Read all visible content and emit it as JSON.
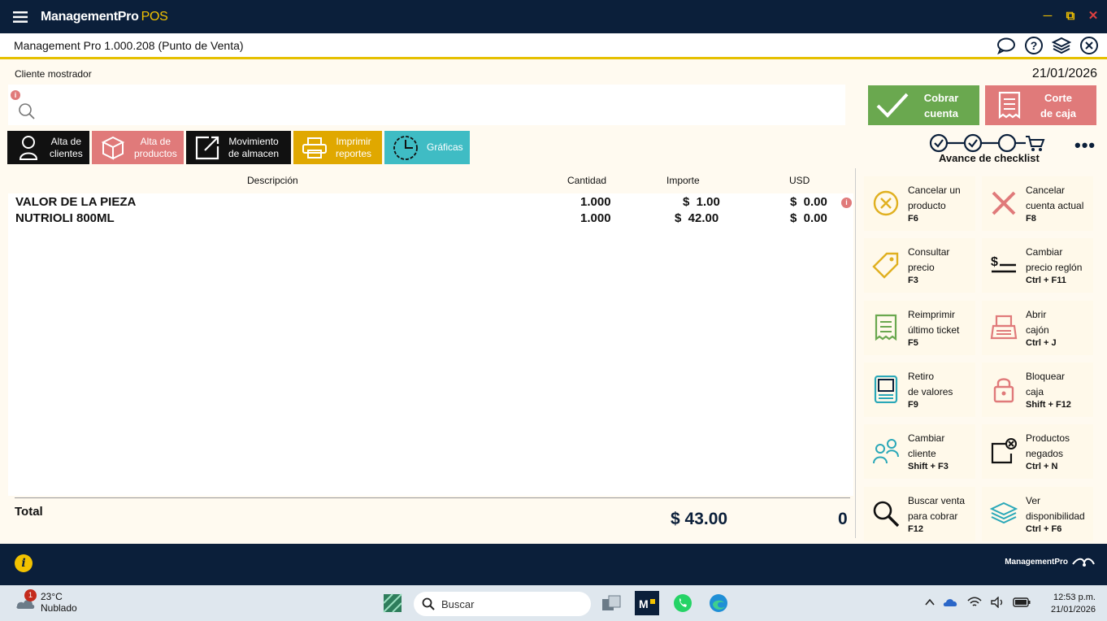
{
  "app": {
    "brand_main": "ManagementPro",
    "brand_pos": "POS",
    "subtitle": "Management Pro 1.000.208 (Punto de Venta)"
  },
  "session": {
    "cliente": "Cliente mostrador",
    "fecha": "21/01/2026"
  },
  "search": {
    "placeholder": ""
  },
  "actions": {
    "cobrar": [
      "Cobrar",
      "cuenta"
    ],
    "corte": [
      "Corte",
      "de caja"
    ]
  },
  "toolbar": [
    {
      "l1": "Alta de",
      "l2": "clientes"
    },
    {
      "l1": "Alta de",
      "l2": "productos"
    },
    {
      "l1": "Movimiento",
      "l2": "de almacen"
    },
    {
      "l1": "Imprimir",
      "l2": "reportes"
    },
    {
      "l1": "Gráficas",
      "l2": ""
    }
  ],
  "checklist": {
    "label": "Avance de checklist"
  },
  "table": {
    "headers": {
      "descripcion": "Descripción",
      "cantidad": "Cantidad",
      "importe": "Importe",
      "usd": "USD"
    },
    "rows": [
      {
        "descripcion": "VALOR DE LA PIEZA",
        "cantidad": "1.000",
        "importe": "$  1.00",
        "usd": "$  0.00"
      },
      {
        "descripcion": "NUTRIOLI 800ML",
        "cantidad": "1.000",
        "importe": "$  42.00",
        "usd": "$  0.00"
      }
    ],
    "total_label": "Total",
    "total_amount": "$ 43.00",
    "total_usd": "0"
  },
  "shortcuts": [
    {
      "t1": "Cancelar un",
      "t2": "producto",
      "key": "F6",
      "icon": "cancel-circle-icon",
      "color": "#e0b020"
    },
    {
      "t1": "Cancelar",
      "t2": "cuenta actual",
      "key": "F8",
      "icon": "cancel-x-icon",
      "color": "#e07a7a"
    },
    {
      "t1": "Consultar",
      "t2": "precio",
      "key": "F3",
      "icon": "price-tag-icon",
      "color": "#e0b020"
    },
    {
      "t1": "Cambiar",
      "t2": "precio reglón",
      "key": "Ctrl + F11",
      "icon": "price-line-icon",
      "color": "#111111"
    },
    {
      "t1": "Reimprimir",
      "t2": "último ticket",
      "key": "F5",
      "icon": "receipt-icon",
      "color": "#6aa84f"
    },
    {
      "t1": "Abrir",
      "t2": "cajón",
      "key": "Ctrl + J",
      "icon": "cash-register-icon",
      "color": "#e07a7a"
    },
    {
      "t1": "Retiro",
      "t2": "de valores",
      "key": "F9",
      "icon": "terminal-icon",
      "color": "#2aa8b8"
    },
    {
      "t1": "Bloquear",
      "t2": "caja",
      "key": "Shift + F12",
      "icon": "lock-icon",
      "color": "#e07a7a"
    },
    {
      "t1": "Cambiar",
      "t2": "cliente",
      "key": "Shift + F3",
      "icon": "users-icon",
      "color": "#2aa8b8"
    },
    {
      "t1": "Productos",
      "t2": "negados",
      "key": "Ctrl + N",
      "icon": "denied-icon",
      "color": "#111111"
    },
    {
      "t1": "Buscar venta",
      "t2": "para cobrar",
      "key": "F12",
      "icon": "magnifier-icon",
      "color": "#111111"
    },
    {
      "t1": "Ver",
      "t2": "disponibilidad",
      "key": "Ctrl + F6",
      "icon": "layers-icon",
      "color": "#2aa8b8"
    }
  ],
  "footer": {
    "logo": "ManagementPro"
  },
  "taskbar": {
    "temp": "23°C",
    "weather": "Nublado",
    "badge": "1",
    "search": "Buscar",
    "time": "12:53 p.m.",
    "date": "21/01/2026"
  },
  "colors": {
    "navy": "#0b1f3a",
    "green": "#6aa84f",
    "salmon": "#e07a7a",
    "gold": "#e0a800",
    "teal": "#3fbcc4",
    "black": "#111111"
  }
}
